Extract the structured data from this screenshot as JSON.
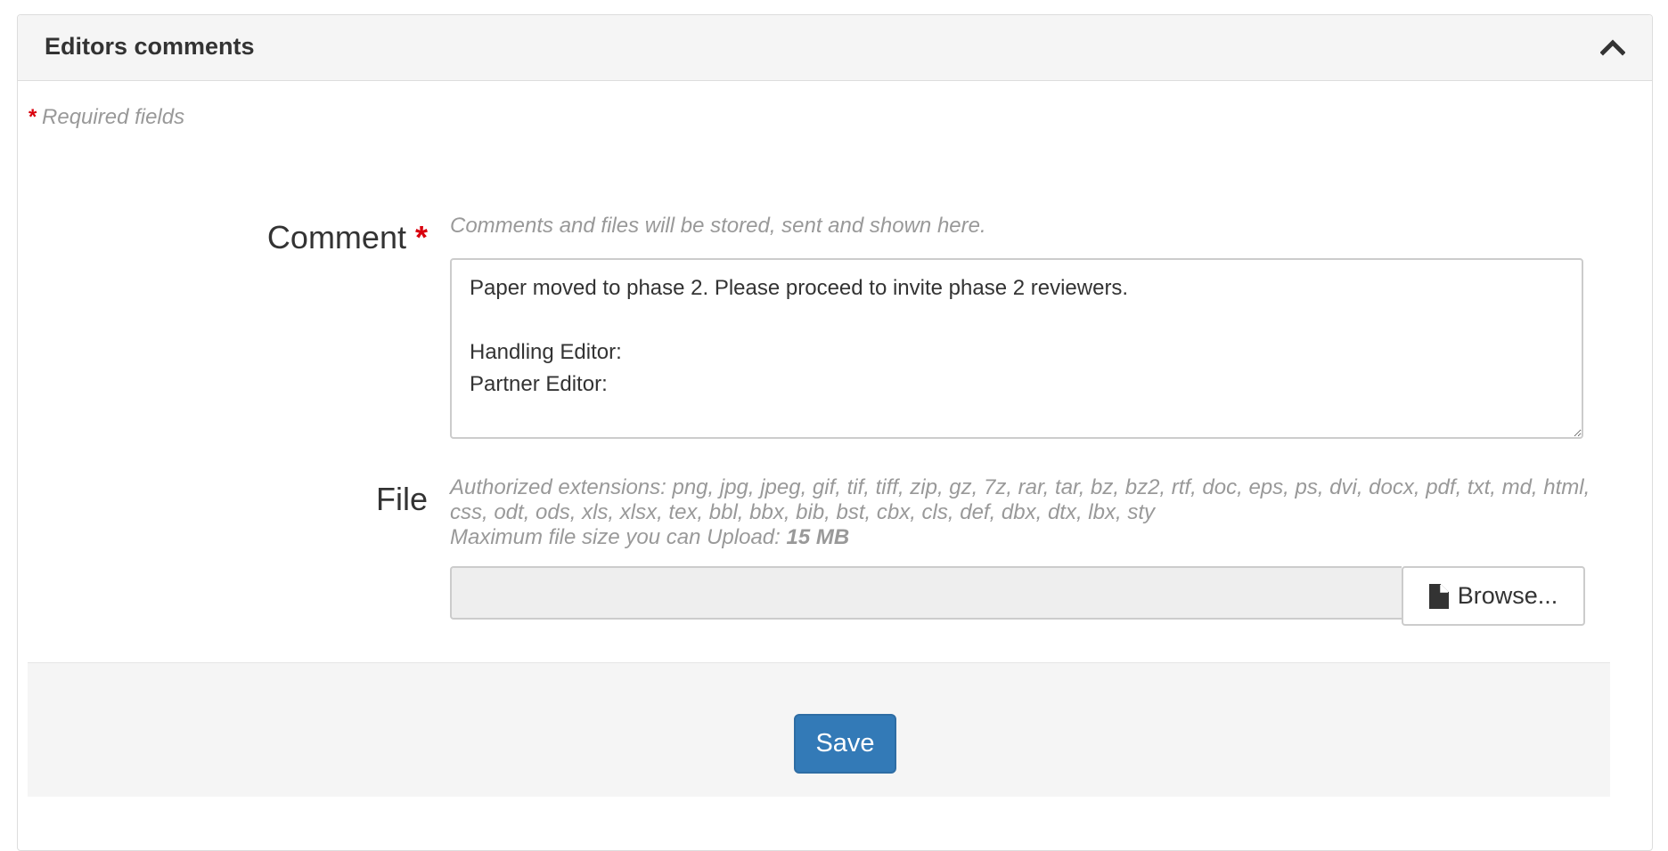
{
  "panel": {
    "title": "Editors comments",
    "collapse_icon": "chevron-up-icon"
  },
  "required_note": {
    "star": "*",
    "text": "Required fields"
  },
  "comment": {
    "label": "Comment",
    "required_star": "*",
    "help": "Comments and files will be stored, sent and shown here.",
    "value": "Paper moved to phase 2. Please proceed to invite phase 2 reviewers.\n\nHandling Editor:\nPartner Editor:"
  },
  "file": {
    "label": "File",
    "extensions_help": "Authorized extensions: png, jpg, jpeg, gif, tif, tiff, zip, gz, 7z, rar, tar, bz, bz2, rtf, doc, eps, ps, dvi, docx, pdf, txt, md, html, css, odt, ods, xls, xlsx, tex, bbl, bbx, bib, bst, cbx, cls, def, dbx, dtx, lbx, sty",
    "max_size_label": "Maximum file size you can Upload:",
    "max_size_value": "15 MB",
    "browse_label": "Browse...",
    "browse_icon": "file-icon"
  },
  "footer": {
    "save_label": "Save"
  },
  "colors": {
    "required_star": "#d9000d",
    "primary_button": "#337ab7",
    "help_text": "#999999",
    "panel_heading_bg": "#f5f5f5"
  }
}
